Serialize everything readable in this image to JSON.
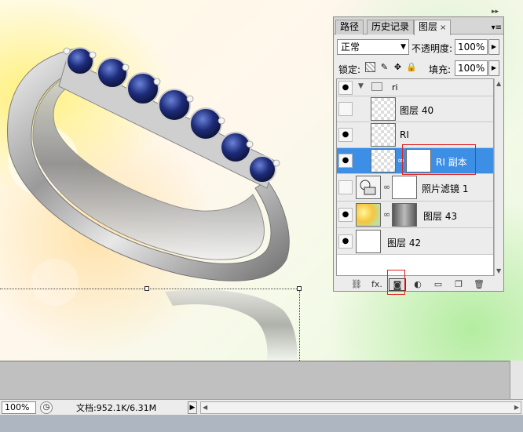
{
  "panel": {
    "tabs": [
      {
        "label": "路径",
        "active": false
      },
      {
        "label": "历史记录",
        "active": false
      },
      {
        "label": "图层",
        "active": true
      }
    ],
    "tab_close": "×",
    "menu_icon": "panel-menu-icon",
    "collapse_icon": "double-chevron-icon",
    "blend_mode": "正常",
    "opacity_label": "不透明度:",
    "opacity_value": "100%",
    "lock_label": "锁定:",
    "fill_label": "填充:",
    "fill_value": "100%"
  },
  "layers": [
    {
      "name": "ri",
      "type": "group",
      "visible": true
    },
    {
      "name": "图层 40",
      "type": "pixel",
      "visible": false
    },
    {
      "name": "RI",
      "type": "pixel",
      "visible": true
    },
    {
      "name": "RI 副本",
      "type": "masked",
      "visible": true,
      "selected": true
    },
    {
      "name": "照片滤镜 1",
      "type": "adjustment",
      "visible": false
    },
    {
      "name": "图层 43",
      "type": "masked-gradient",
      "visible": true
    },
    {
      "name": "图层 42",
      "type": "pixel-white",
      "visible": true
    }
  ],
  "footer_icons": [
    "link-icon",
    "fx-icon",
    "add-mask-icon",
    "adjustment-icon",
    "folder-icon",
    "new-layer-icon",
    "trash-icon"
  ],
  "footer_labels": {
    "fx": "fx."
  },
  "status": {
    "zoom": "100%",
    "doc_info": "文档:952.1K/6.31M"
  },
  "colors": {
    "selected_row": "#3d8fe6",
    "highlight": "#e02020"
  }
}
